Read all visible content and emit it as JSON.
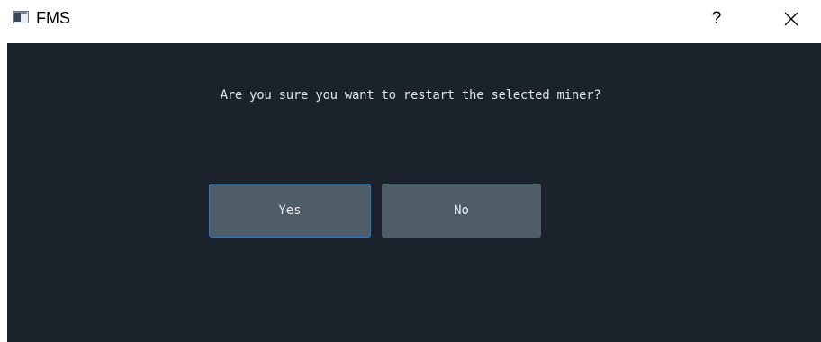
{
  "window": {
    "title": "FMS",
    "icon": "app-window-icon",
    "help_label": "?",
    "close_icon": "close-icon"
  },
  "dialog": {
    "message": "Are you sure you want to restart the selected miner?",
    "yes_label": "Yes",
    "no_label": "No",
    "focused_button": "Yes"
  },
  "colors": {
    "background": "#1b222b",
    "button": "#4f5d69",
    "focus_border": "#1f7ad0",
    "text": "#dfe3e8"
  }
}
